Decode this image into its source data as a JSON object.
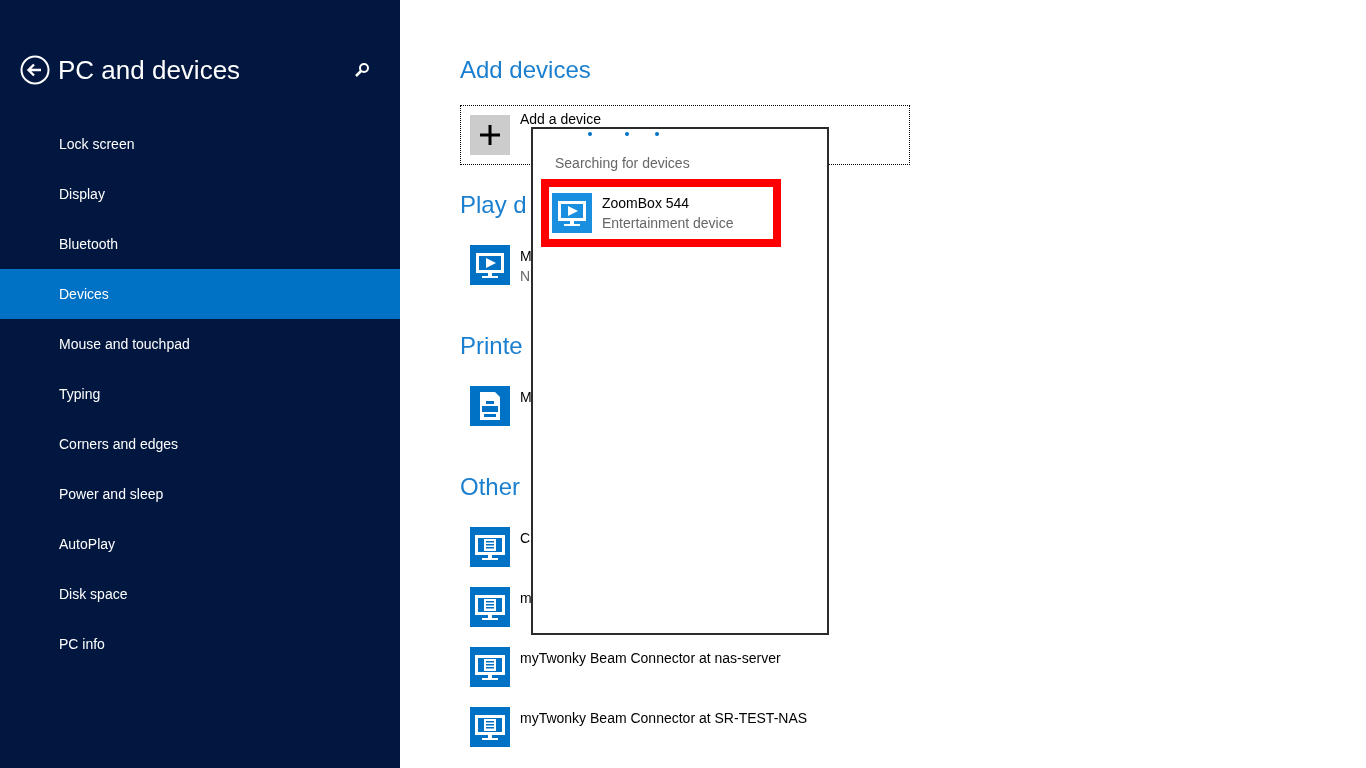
{
  "sidebar": {
    "title": "PC and devices",
    "items": [
      {
        "label": "Lock screen",
        "selected": false
      },
      {
        "label": "Display",
        "selected": false
      },
      {
        "label": "Bluetooth",
        "selected": false
      },
      {
        "label": "Devices",
        "selected": true
      },
      {
        "label": "Mouse and touchpad",
        "selected": false
      },
      {
        "label": "Typing",
        "selected": false
      },
      {
        "label": "Corners and edges",
        "selected": false
      },
      {
        "label": "Power and sleep",
        "selected": false
      },
      {
        "label": "AutoPlay",
        "selected": false
      },
      {
        "label": "Disk space",
        "selected": false
      },
      {
        "label": "PC info",
        "selected": false
      }
    ]
  },
  "add_devices": {
    "heading": "Add devices",
    "button": "Add a device"
  },
  "sections": [
    {
      "heading": "Play d",
      "devices": [
        {
          "kind": "media",
          "name": "M",
          "status": "N"
        }
      ]
    },
    {
      "heading": "Printe",
      "devices": [
        {
          "kind": "printer",
          "name": "M"
        }
      ]
    },
    {
      "heading": "Other",
      "devices": [
        {
          "kind": "other",
          "name": "C"
        },
        {
          "kind": "other",
          "name": "m"
        },
        {
          "kind": "other",
          "name": "myTwonky Beam Connector at nas-server"
        },
        {
          "kind": "other",
          "name": "myTwonky Beam Connector at SR-TEST-NAS"
        }
      ]
    }
  ],
  "popup": {
    "status": "Searching for devices",
    "results": [
      {
        "name": "ZoomBox 544",
        "type": "Entertainment device",
        "highlighted": true
      }
    ]
  }
}
